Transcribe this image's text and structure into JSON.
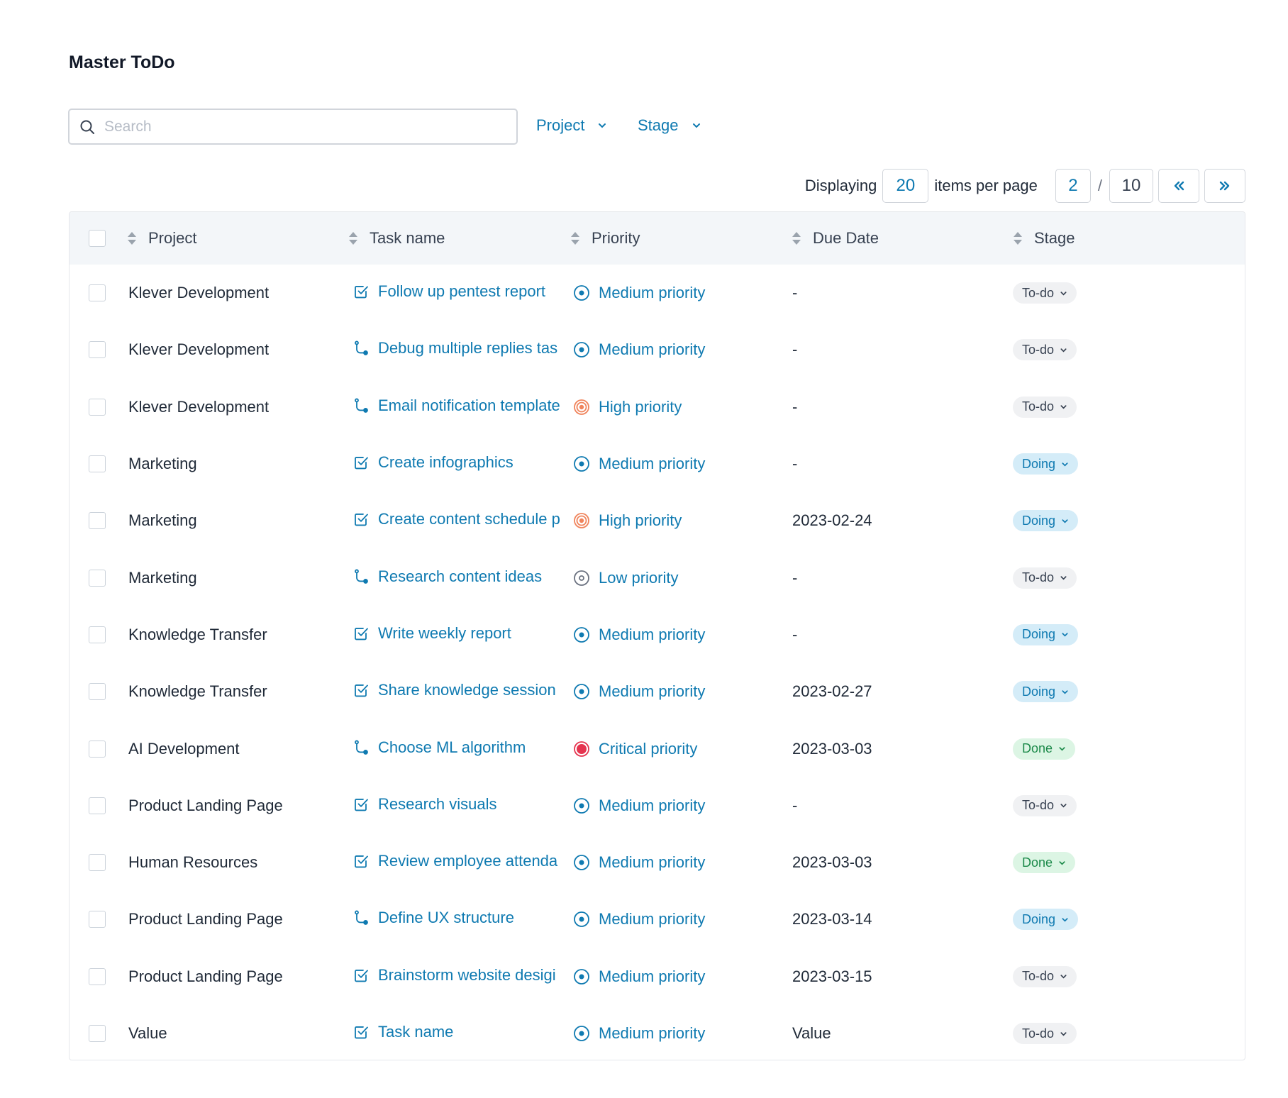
{
  "page": {
    "title": "Master ToDo"
  },
  "search": {
    "placeholder": "Search",
    "value": ""
  },
  "filters": {
    "project_label": "Project",
    "stage_label": "Stage"
  },
  "pagination": {
    "displaying_label": "Displaying",
    "per_page": "20",
    "items_per_page_label": "items per page",
    "current_page": "2",
    "separator": "/",
    "total_pages": "10",
    "first_label": "«",
    "last_label": "»"
  },
  "table": {
    "headers": {
      "project": "Project",
      "task_name": "Task name",
      "priority": "Priority",
      "due_date": "Due Date",
      "stage": "Stage"
    },
    "rows": [
      {
        "project": "Klever Development",
        "task": "Follow up pentest report",
        "task_icon": "checkbox-task-icon",
        "priority": "Medium priority",
        "priority_level": "medium",
        "due": "-",
        "stage": "To-do"
      },
      {
        "project": "Klever Development",
        "task": "Debug multiple replies tas",
        "task_icon": "subtask-icon",
        "priority": "Medium priority",
        "priority_level": "medium",
        "due": "-",
        "stage": "To-do"
      },
      {
        "project": "Klever Development",
        "task": "Email notification template",
        "task_icon": "subtask-icon",
        "priority": "High priority",
        "priority_level": "high",
        "due": "-",
        "stage": "To-do"
      },
      {
        "project": "Marketing",
        "task": "Create infographics",
        "task_icon": "checkbox-task-icon",
        "priority": "Medium priority",
        "priority_level": "medium",
        "due": "-",
        "stage": "Doing"
      },
      {
        "project": "Marketing",
        "task": "Create content schedule p",
        "task_icon": "checkbox-task-icon",
        "priority": "High priority",
        "priority_level": "high",
        "due": "2023-02-24",
        "stage": "Doing"
      },
      {
        "project": "Marketing",
        "task": "Research content ideas",
        "task_icon": "subtask-icon",
        "priority": "Low priority",
        "priority_level": "low",
        "due": "-",
        "stage": "To-do"
      },
      {
        "project": "Knowledge Transfer",
        "task": "Write weekly report",
        "task_icon": "checkbox-task-icon",
        "priority": "Medium priority",
        "priority_level": "medium",
        "due": "-",
        "stage": "Doing"
      },
      {
        "project": "Knowledge Transfer",
        "task": "Share knowledge session",
        "task_icon": "checkbox-task-icon",
        "priority": "Medium priority",
        "priority_level": "medium",
        "due": "2023-02-27",
        "stage": "Doing"
      },
      {
        "project": "AI Development",
        "task": "Choose ML algorithm",
        "task_icon": "subtask-icon",
        "priority": "Critical priority",
        "priority_level": "critical",
        "due": "2023-03-03",
        "stage": "Done"
      },
      {
        "project": "Product Landing Page",
        "task": "Research visuals",
        "task_icon": "checkbox-task-icon",
        "priority": "Medium priority",
        "priority_level": "medium",
        "due": "-",
        "stage": "To-do"
      },
      {
        "project": "Human Resources",
        "task": "Review employee attenda",
        "task_icon": "checkbox-task-icon",
        "priority": "Medium priority",
        "priority_level": "medium",
        "due": "2023-03-03",
        "stage": "Done"
      },
      {
        "project": "Product Landing Page",
        "task": "Define UX structure",
        "task_icon": "subtask-icon",
        "priority": "Medium priority",
        "priority_level": "medium",
        "due": "2023-03-14",
        "stage": "Doing"
      },
      {
        "project": "Product Landing Page",
        "task": "Brainstorm website desigi",
        "task_icon": "checkbox-task-icon",
        "priority": "Medium priority",
        "priority_level": "medium",
        "due": "2023-03-15",
        "stage": "To-do"
      },
      {
        "project": "Value",
        "task": "Task name",
        "task_icon": "checkbox-task-icon",
        "priority": "Medium priority",
        "priority_level": "medium",
        "due": "Value",
        "stage": "To-do"
      }
    ]
  },
  "colors": {
    "accent": "#0f7ab1",
    "header_bg": "#f3f6f9",
    "priority_medium": "#0f7ab1",
    "priority_high": "#f0845c",
    "priority_low": "#6b7280",
    "priority_critical": "#e5344f",
    "stage_todo_bg": "#f0f1f3",
    "stage_doing_bg": "#d4ecf8",
    "stage_done_bg": "#dcf5e4"
  }
}
